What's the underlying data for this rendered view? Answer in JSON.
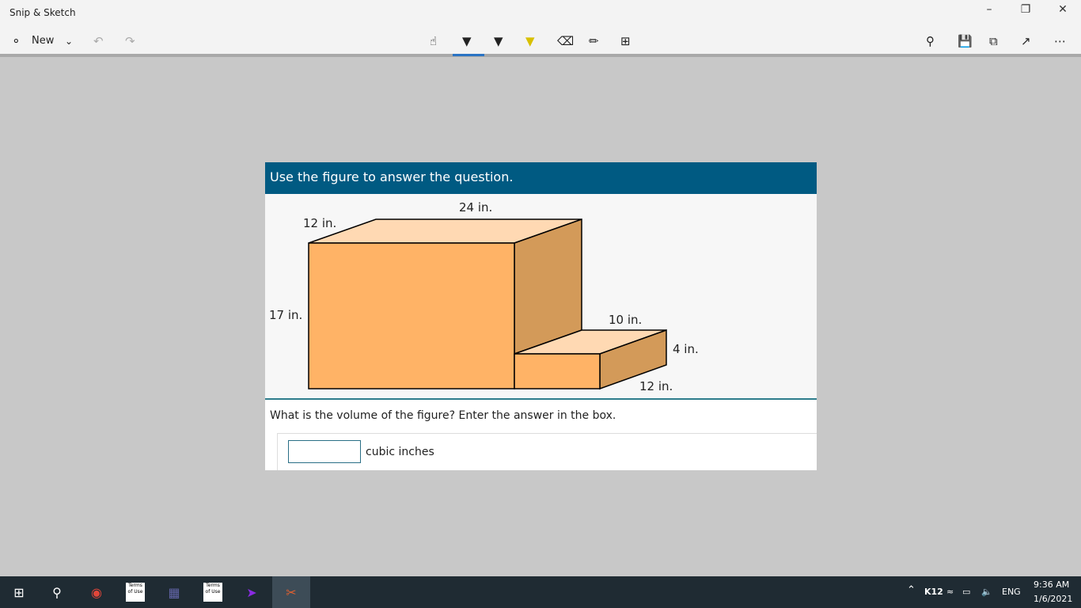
{
  "window": {
    "title": "Snip & Sketch"
  },
  "toolbar": {
    "new_label": "New",
    "tools": [
      "touch-writing",
      "ballpoint-pen",
      "pencil",
      "highlighter",
      "eraser",
      "ruler",
      "crop"
    ],
    "selected_tool": "ballpoint-pen"
  },
  "question": {
    "header": "Use the figure to answer the question.",
    "labels": {
      "big_depth": "12 in.",
      "big_width": "24 in.",
      "big_height": "17 in.",
      "small_width": "10 in.",
      "small_height": "4 in.",
      "small_depth": "12 in."
    },
    "prompt": "What is the volume of the figure? Enter the answer in the box.",
    "answer_value": "",
    "unit": "cubic inches",
    "colors": {
      "front": "#ffb366",
      "top": "#ffd9b3",
      "side": "#d39a59",
      "header": "#005a82"
    }
  },
  "taskbar": {
    "tray": {
      "k12": "K12",
      "lang": "ENG",
      "time": "9:36 AM",
      "date": "1/6/2021"
    },
    "apps": [
      "Start",
      "Search",
      "Chrome",
      "Terms of Use",
      "Teams",
      "Terms of Use",
      "Power Automate",
      "Snip & Sketch"
    ],
    "terms_label": "Terms of Use"
  }
}
